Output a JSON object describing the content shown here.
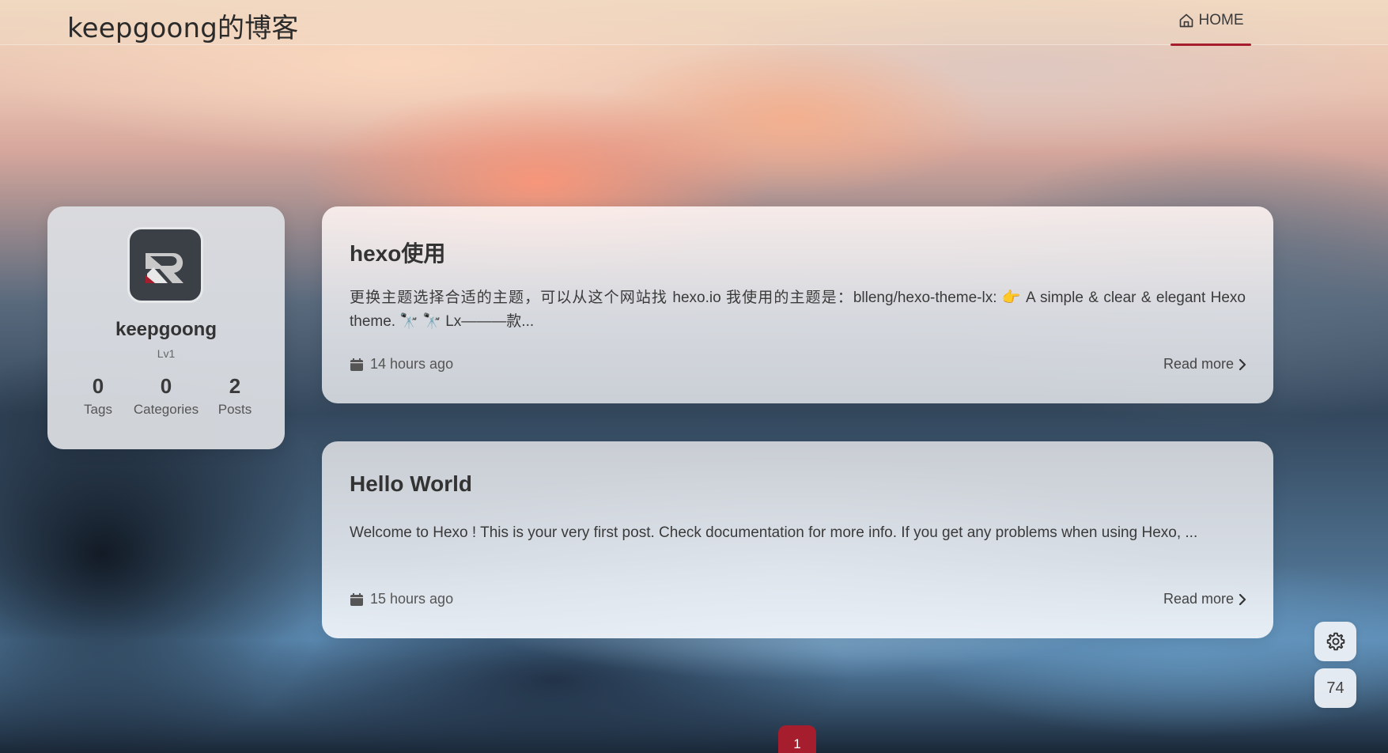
{
  "header": {
    "site_title": "keepgoong的博客",
    "nav": {
      "home_label": "HOME",
      "home_icon": "home-icon"
    }
  },
  "profile": {
    "name": "keepgoong",
    "level": "Lv1",
    "avatar_icon": "logo-avatar",
    "stats": [
      {
        "value": "0",
        "label": "Tags"
      },
      {
        "value": "0",
        "label": "Categories"
      },
      {
        "value": "2",
        "label": "Posts"
      }
    ]
  },
  "posts": [
    {
      "title": "hexo使用",
      "excerpt": "更换主题选择合适的主题，可以从这个网站找 hexo.io 我使用的主题是：blleng/hexo-theme-lx: 👉 A simple & clear & elegant Hexo theme. 🔭 🔭 Lx———款...",
      "time": "14 hours ago",
      "read_more": "Read more"
    },
    {
      "title": "Hello World",
      "excerpt": "Welcome to Hexo ! This is your very first post. Check documentation for more info. If you get any problems when using Hexo, ...",
      "time": "15 hours ago",
      "read_more": "Read more"
    }
  ],
  "floating": {
    "settings_icon": "gear-icon",
    "progress": "74"
  },
  "pagination": {
    "current_page": "1"
  },
  "colors": {
    "accent": "#a61d2d"
  }
}
